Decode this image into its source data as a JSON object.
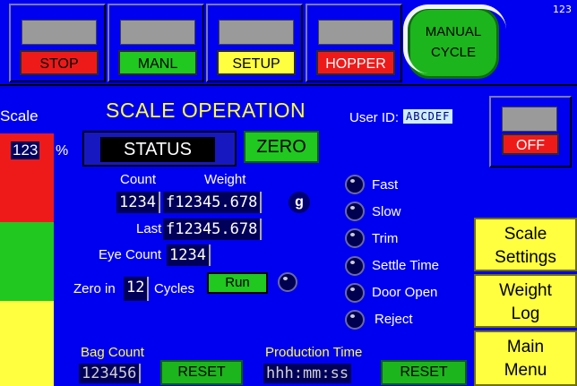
{
  "top": {
    "buttons": [
      {
        "label": "STOP",
        "color": "#ee1a1a",
        "fg": "#000000"
      },
      {
        "label": "MANL",
        "color": "#20c820",
        "fg": "#000000"
      },
      {
        "label": "SETUP",
        "color": "#ffff40",
        "fg": "#000000"
      },
      {
        "label": "HOPPER",
        "color": "#ee1a1a",
        "fg": "#ffffff"
      }
    ],
    "cycle_line1": "MANUAL",
    "cycle_line2": "CYCLE",
    "corner_value": "123"
  },
  "scale": {
    "label": "Scale",
    "percent_value": "123",
    "percent_sign": "%",
    "bar_colors": [
      "#ee1a1a",
      "#20c820",
      "#ffff40"
    ]
  },
  "main": {
    "title": "SCALE OPERATION",
    "user_id_label": "User ID:",
    "user_id_value": "ABCDEF",
    "status_label": "STATUS",
    "zero_label": "ZERO",
    "off_label": "OFF",
    "count_header": "Count",
    "weight_header": "Weight",
    "count_value": "1234",
    "weight_value": "f12345.678",
    "unit": "g",
    "last_label": "Last",
    "last_value": "f12345.678",
    "eye_count_label": "Eye Count",
    "eye_count_value": "1234",
    "zero_in_label": "Zero in",
    "zero_in_value": "12",
    "cycles_label": "Cycles",
    "run_label": "Run"
  },
  "indicators": [
    "Fast",
    "Slow",
    "Trim",
    "Settle Time",
    "Door Open",
    "Reject"
  ],
  "side_buttons": [
    {
      "line1": "Scale",
      "line2": "Settings"
    },
    {
      "line1": "Weight",
      "line2": "Log"
    },
    {
      "line1": "Main",
      "line2": "Menu"
    }
  ],
  "bottom": {
    "bag_count_label": "Bag Count",
    "bag_count_value": "123456",
    "production_time_label": "Production Time",
    "production_time_value": "hhh:mm:ss",
    "reset_label": "RESET"
  }
}
